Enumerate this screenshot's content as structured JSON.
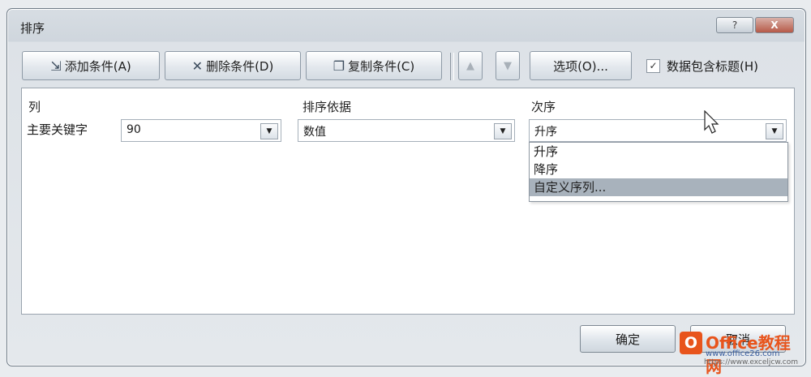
{
  "dialog": {
    "title": "排序"
  },
  "window_buttons": {
    "help": "?",
    "close": "X"
  },
  "toolbar": {
    "add_label": "添加条件(A)",
    "delete_label": "删除条件(D)",
    "copy_label": "复制条件(C)",
    "up_symbol": "▲",
    "down_symbol": "▼",
    "options_label": "选项(O)...",
    "header_checkbox_label": "数据包含标题(H)",
    "header_checkbox_checked": "✓"
  },
  "grid": {
    "col_header": "列",
    "sort_on_header": "排序依据",
    "order_header": "次序",
    "row_label": "主要关键字",
    "column_value": "90",
    "sort_on_value": "数值",
    "order_value": "升序",
    "dropdown_arrow": "▼"
  },
  "order_options": [
    "升序",
    "降序",
    "自定义序列..."
  ],
  "selected_option_index": 2,
  "footer": {
    "ok_label": "确定",
    "cancel_label": "取消"
  },
  "watermark": {
    "logo": "O",
    "brand": "Office教程网",
    "url": "www.office26.com",
    "url2": "https://www.exceljcw.com"
  },
  "colors": {
    "selection": "#a8b2bc",
    "brand_orange": "#e8541c"
  },
  "icons": {
    "add": "add-condition-icon",
    "delete": "delete-icon",
    "copy": "copy-icon",
    "up": "arrow-up-icon",
    "down": "arrow-down-icon",
    "cursor": "mouse-cursor-icon"
  }
}
